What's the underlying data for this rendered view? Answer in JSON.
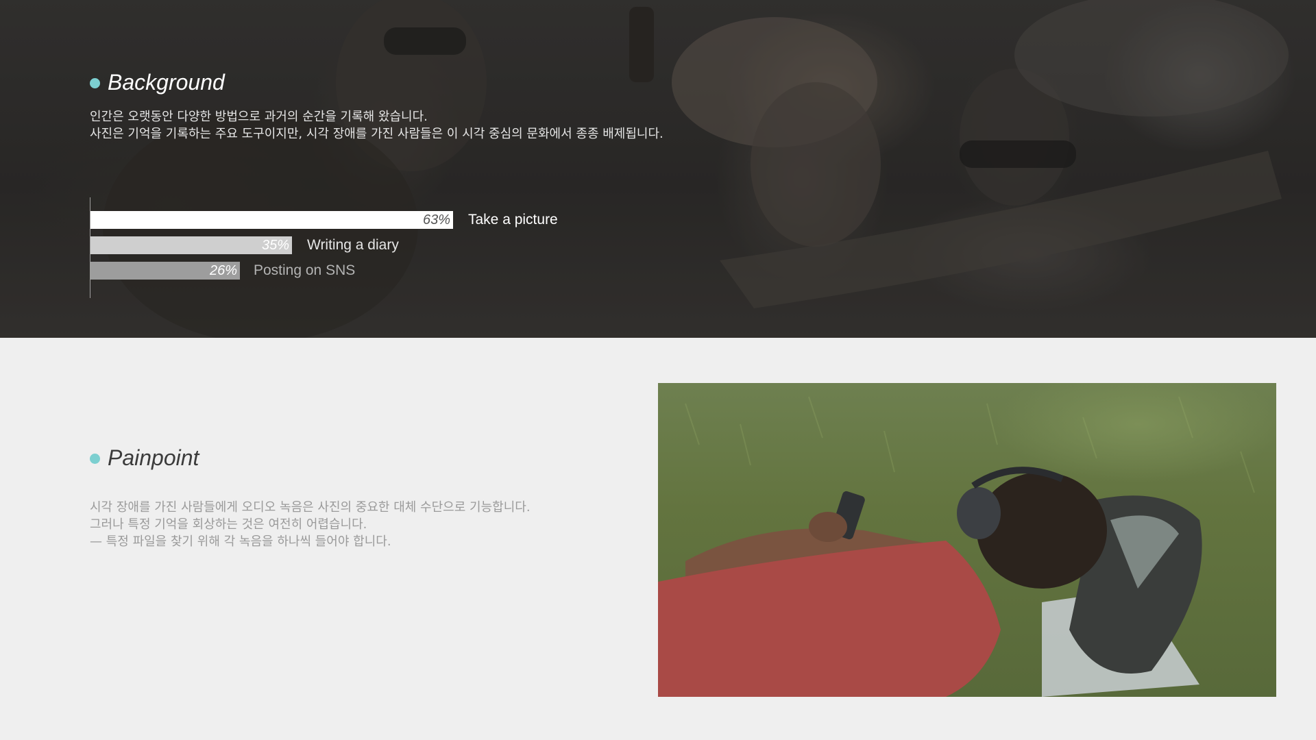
{
  "background": {
    "title": "Background",
    "lines": [
      "인간은 오랫동안 다양한 방법으로 과거의 순간을 기록해 왔습니다.",
      "사진은 기억을 기록하는 주요 도구이지만,  시각 장애를 가진 사람들은 이 시각 중심의 문화에서 종종 배제됩니다."
    ],
    "bars": [
      {
        "label": "Take a picture",
        "pct_label": "63%",
        "value": 63,
        "fill": "#ffffff",
        "pct_color": "#555555",
        "label_color": "#ffffff"
      },
      {
        "label": "Writing a diary",
        "pct_label": "35%",
        "value": 35,
        "fill": "#cfcfcf",
        "pct_color": "#ffffff",
        "label_color": "#e6e6e6"
      },
      {
        "label": "Posting on SNS",
        "pct_label": "26%",
        "value": 26,
        "fill": "#9d9d9d",
        "pct_color": "#ffffff",
        "label_color": "#b3b3b3"
      }
    ]
  },
  "painpoint": {
    "title": "Painpoint",
    "lines": [
      "시각 장애를 가진 사람들에게 오디오 녹음은 사진의 중요한 대체 수단으로 기능합니다.",
      "그러나 특정 기억을 회상하는 것은 여전히 어렵습니다.",
      "— 특정 파일을 찾기 위해 각 녹음을 하나씩 들어야 합니다."
    ]
  },
  "colors": {
    "accent_dot": "#7ccfd0",
    "page_bg": "#efefef",
    "pain_text": "#9a9a9a"
  }
}
